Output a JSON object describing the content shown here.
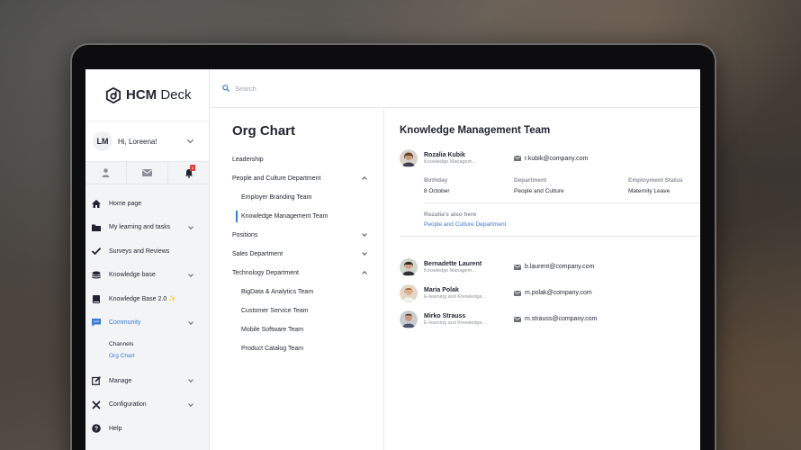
{
  "app": {
    "logo_bold": "HCM",
    "logo_rest": " Deck"
  },
  "user": {
    "initials": "LM",
    "greeting": "Hi, Loreena!"
  },
  "notifications": {
    "count": "1"
  },
  "sidebar": {
    "items": [
      {
        "label": "Home page",
        "icon": "home-icon"
      },
      {
        "label": "My learning and tasks",
        "icon": "folder-icon"
      },
      {
        "label": "Surveys and Reviews",
        "icon": "check-icon"
      },
      {
        "label": "Knowledge base",
        "icon": "book-icon"
      },
      {
        "label": "Knowledge Base 2.0 ✨",
        "icon": "book2-icon"
      },
      {
        "label": "Community",
        "icon": "chat-icon"
      }
    ],
    "community_sub": [
      "Channels",
      "Org Chart"
    ],
    "items_after": [
      {
        "label": "Manage",
        "icon": "edit-icon"
      },
      {
        "label": "Configuration",
        "icon": "tools-icon"
      },
      {
        "label": "Help",
        "icon": "help-icon"
      }
    ]
  },
  "search": {
    "placeholder": "Search"
  },
  "org": {
    "title": "Org Chart",
    "tree": [
      {
        "label": "Leadership",
        "level": 0
      },
      {
        "label": "People and Culture Department",
        "level": 0,
        "expanded": true
      },
      {
        "label": "Employer Branding Team",
        "level": 1
      },
      {
        "label": "Knowledge Management Team",
        "level": 1,
        "active": true
      },
      {
        "label": "Positions",
        "level": 0,
        "collapsed": true
      },
      {
        "label": "Sales Department",
        "level": 0,
        "collapsed": true
      },
      {
        "label": "Technology Department",
        "level": 0,
        "expanded": true
      },
      {
        "label": "BigData & Analytics Team",
        "level": 1
      },
      {
        "label": "Customer Service Team",
        "level": 1
      },
      {
        "label": "Mobile Software Team",
        "level": 1
      },
      {
        "label": "Product Catalog Team",
        "level": 1
      }
    ]
  },
  "team": {
    "title": "Knowledge Management Team",
    "lead": {
      "name": "Rozalia Kubik",
      "role": "Knowledge Managem...",
      "email": "r.kubik@company.com",
      "birthday_label": "Birthday",
      "birthday": "8 October",
      "department_label": "Department",
      "department": "People and Culture",
      "status_label": "Employment Status",
      "status": "Maternity Leave",
      "also_label": "Rozalia's also here",
      "also_value": "People and Culture Department"
    },
    "members": [
      {
        "name": "Bernadette Laurent",
        "role": "Knowledge Managem...",
        "email": "b.laurent@company.com"
      },
      {
        "name": "Maria Polak",
        "role": "E-learning and Knowledge...",
        "email": "m.polak@company.com"
      },
      {
        "name": "Mirko Strauss",
        "role": "E-learning and Knowledge...",
        "email": "m.strauss@company.com"
      }
    ]
  },
  "colors": {
    "accent": "#3a7bd5",
    "text": "#1f2430",
    "muted": "#8a9099",
    "badge": "#e23b3b"
  }
}
